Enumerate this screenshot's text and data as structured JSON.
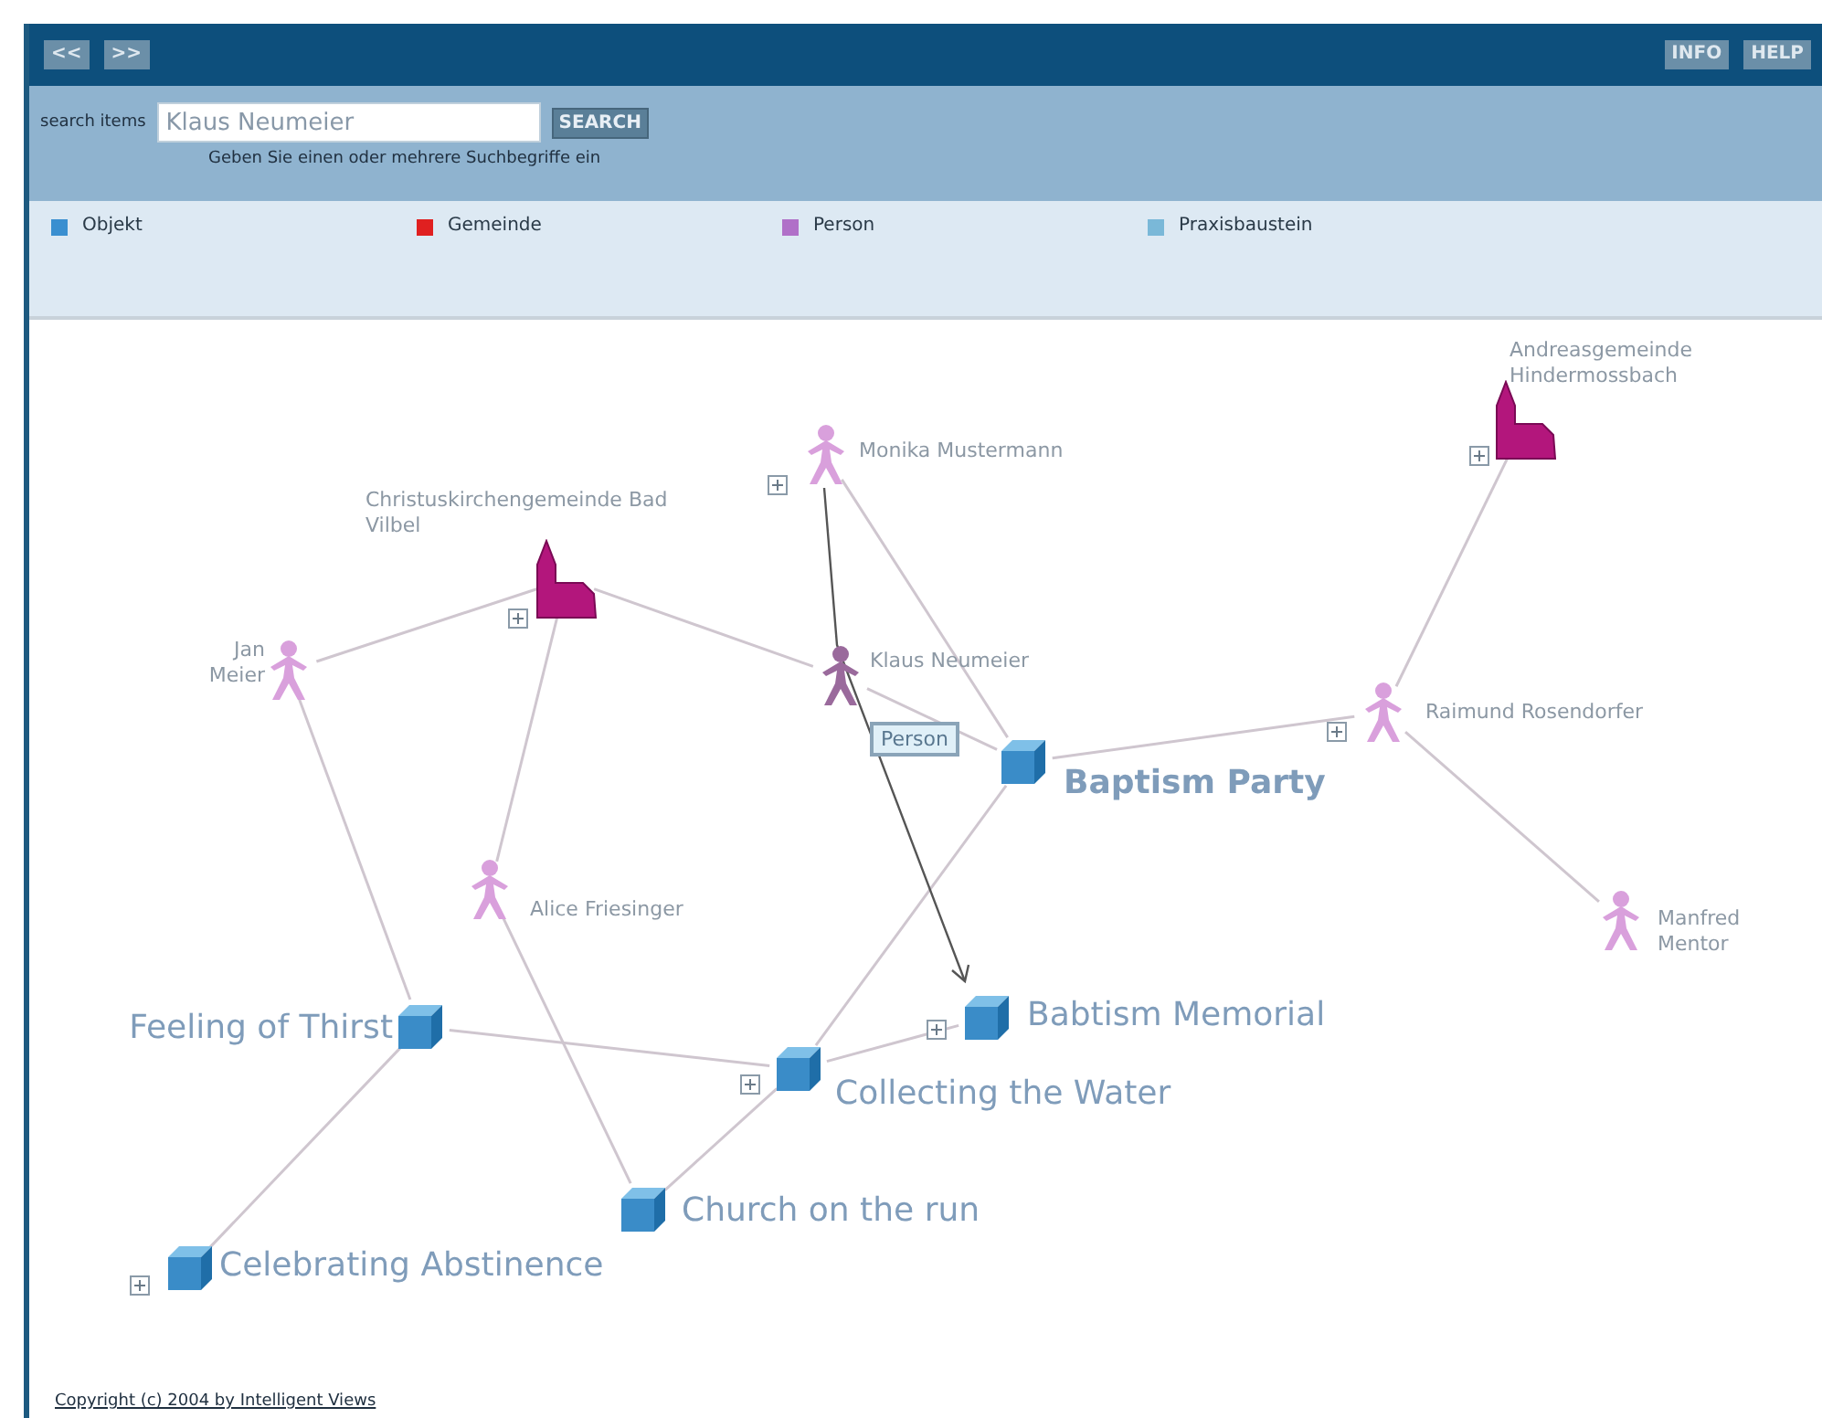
{
  "toolbar": {
    "nav_buttons": [
      "<<",
      ">>"
    ],
    "right_buttons": [
      "INFO",
      "HELP"
    ]
  },
  "search": {
    "label": "search items",
    "value": "Klaus Neumeier",
    "button": "SEARCH",
    "hint": "Geben Sie einen oder mehrere Suchbegriffe ein"
  },
  "legend": [
    {
      "label": "Objekt",
      "color": "#3a8fd0"
    },
    {
      "label": "Gemeinde",
      "color": "#e02020"
    },
    {
      "label": "Person",
      "color": "#b070c8"
    },
    {
      "label": "Praxisbaustein",
      "color": "#7ab8d8"
    }
  ],
  "graph": {
    "nodes": [
      {
        "kind": "church",
        "label": "Andreasgemeinde Hindermossbach",
        "expandable": true,
        "selected": false,
        "emphasized": false
      },
      {
        "kind": "person",
        "label": "Monika Mustermann",
        "expandable": true,
        "selected": false,
        "emphasized": false
      },
      {
        "kind": "church",
        "label": "Christuskirchengemeinde Bad Vilbel",
        "expandable": true,
        "selected": false,
        "emphasized": false
      },
      {
        "kind": "person",
        "label": "Jan Meier",
        "expandable": false,
        "selected": false,
        "emphasized": false
      },
      {
        "kind": "person",
        "label": "Klaus Neumeier",
        "expandable": false,
        "selected": true,
        "emphasized": false
      },
      {
        "kind": "person",
        "label": "Raimund Rosendorfer",
        "expandable": true,
        "selected": false,
        "emphasized": false
      },
      {
        "kind": "object",
        "label": "Baptism Party",
        "expandable": false,
        "selected": false,
        "emphasized": true
      },
      {
        "kind": "person",
        "label": "Alice Friesinger",
        "expandable": false,
        "selected": false,
        "emphasized": false
      },
      {
        "kind": "person",
        "label": "Manfred Mentor",
        "expandable": false,
        "selected": false,
        "emphasized": false
      },
      {
        "kind": "object",
        "label": "Feeling of Thirst",
        "expandable": false,
        "selected": false,
        "emphasized": false
      },
      {
        "kind": "object",
        "label": "Babtism Memorial",
        "expandable": true,
        "selected": false,
        "emphasized": false
      },
      {
        "kind": "object",
        "label": "Collecting the Water",
        "expandable": true,
        "selected": false,
        "emphasized": false
      },
      {
        "kind": "object",
        "label": "Church on the run",
        "expandable": false,
        "selected": false,
        "emphasized": false
      },
      {
        "kind": "object",
        "label": "Celebrating Abstinence",
        "expandable": true,
        "selected": false,
        "emphasized": false
      }
    ],
    "tooltip": "Person"
  },
  "footer": {
    "copyright": "Copyright (c) 2004 by Intelligent Views"
  }
}
